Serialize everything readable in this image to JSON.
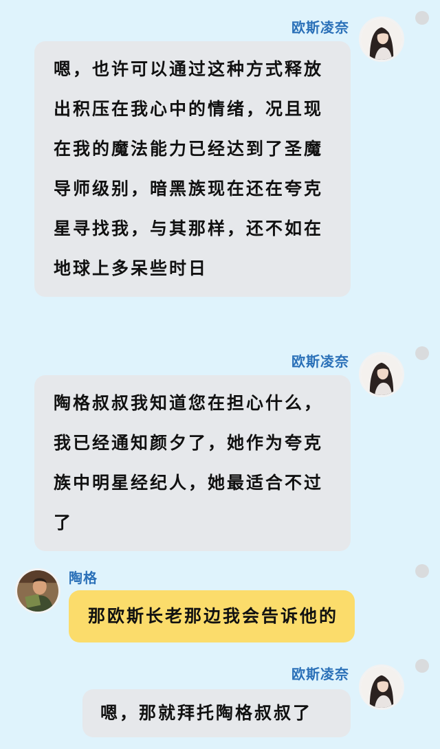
{
  "colors": {
    "background": "#dff3fc",
    "sender_name": "#2a70b8",
    "bubble_other": "#e6e8eb",
    "bubble_tao_ge": "#fbdc6b",
    "status_dot": "#d9dbdd"
  },
  "messages": [
    {
      "sender": "欧斯凌奈",
      "avatar_icon": "girl-portrait-icon",
      "text": "嗯，也许可以通过这种方式释放出积压在我心中的情绪，况且现在我的魔法能力已经达到了圣魔导师级别，暗黑族现在还在夸克星寻找我，与其那样，还不如在地球上多呆些时日"
    },
    {
      "sender": "欧斯凌奈",
      "avatar_icon": "girl-portrait-icon",
      "text": "陶格叔叔我知道您在担心什么，我已经通知颜夕了，她作为夸克族中明星经纪人，她最适合不过了"
    },
    {
      "sender": "陶格",
      "avatar_icon": "man-reading-portrait-icon",
      "text": "那欧斯长老那边我会告诉他的"
    },
    {
      "sender": "欧斯凌奈",
      "avatar_icon": "girl-portrait-icon",
      "text": "嗯，那就拜托陶格叔叔了"
    }
  ]
}
